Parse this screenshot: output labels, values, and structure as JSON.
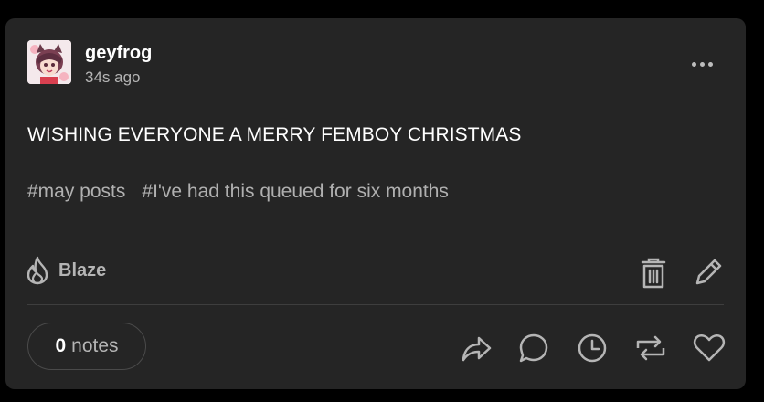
{
  "post": {
    "username": "geyfrog",
    "timestamp": "34s ago",
    "text": "WISHING EVERYONE A MERRY FEMBOY CHRISTMAS",
    "tags": [
      "#may posts",
      "#I've had this queued for six months"
    ]
  },
  "actions": {
    "blaze_label": "Blaze",
    "notes_count": "0",
    "notes_label": "notes"
  },
  "icons": {
    "more": "more-horizontal-icon",
    "blaze": "flame-icon",
    "delete": "trash-icon",
    "edit": "pencil-icon",
    "share": "share-icon",
    "reply": "comment-icon",
    "queue": "clock-icon",
    "reblog": "reblog-icon",
    "like": "heart-icon"
  },
  "colors": {
    "background": "#000000",
    "card": "#252525",
    "text": "#ffffff",
    "muted": "#b5b5b5"
  }
}
